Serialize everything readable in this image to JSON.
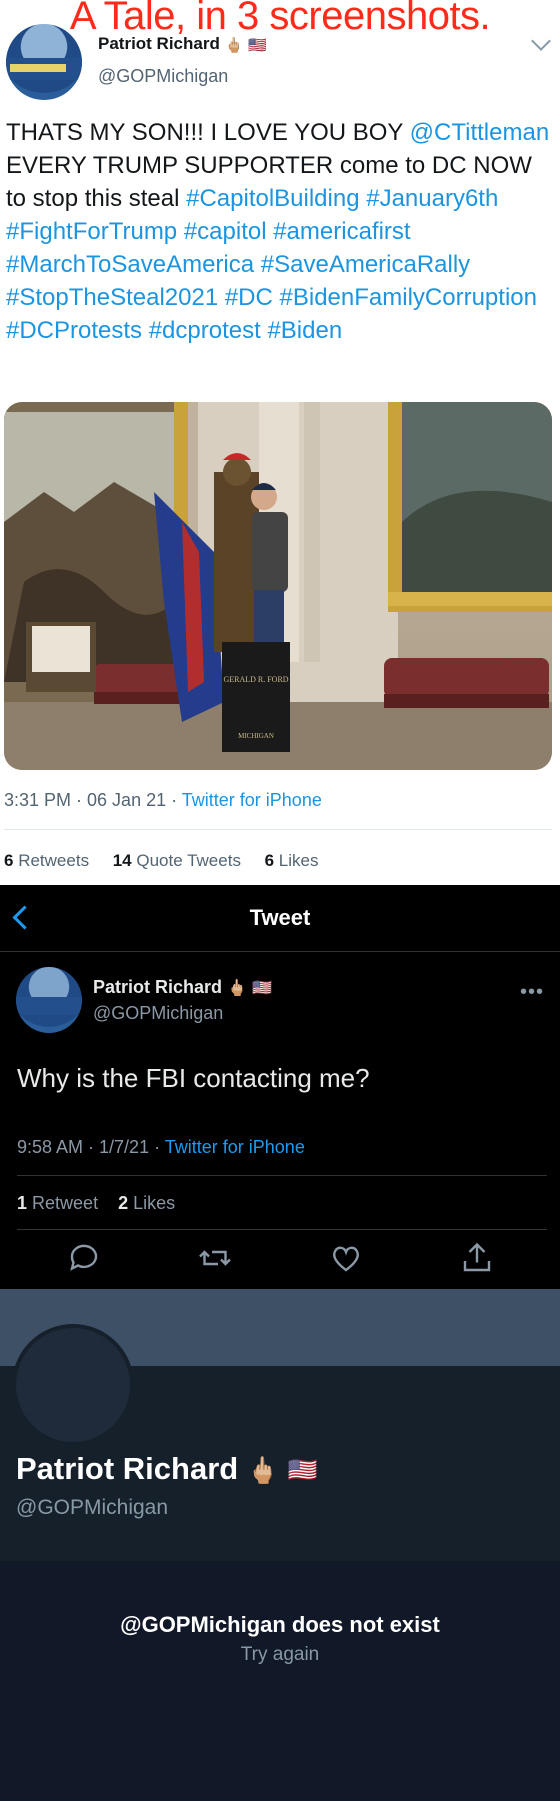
{
  "overlay": {
    "title": "A Tale, in 3 screenshots."
  },
  "tweet1": {
    "name": "Patriot Richard",
    "handle": "@GOPMichigan",
    "text_lead": "THATS MY SON!!! I LOVE YOU BOY",
    "mention": "@CTittleman",
    "text_mid": "EVERY TRUMP SUPPORTER come to DC NOW to stop this steal",
    "hashtags": "#CapitolBuilding #January6th #FightForTrump #capitol #americafirst #MarchToSaveAmerica #SaveAmericaRally #StopTheSteal2021 #DC #BidenFamilyCorruption #DCProtests #dcprotest #Biden",
    "time": "3:31 PM · 06 Jan 21 · ",
    "source": "Twitter for iPhone",
    "retweets_count": "6",
    "retweets_label": "Retweets",
    "quotes_count": "14",
    "quotes_label": "Quote Tweets",
    "likes_count": "6",
    "likes_label": "Likes",
    "photo_plaque_name": "GERALD R. FORD",
    "photo_plaque_state": "MICHIGAN"
  },
  "tweet2": {
    "header_title": "Tweet",
    "name": "Patriot Richard",
    "handle": "@GOPMichigan",
    "text": "Why is the FBI contacting me?",
    "time": "9:58 AM · 1/7/21 · ",
    "source": "Twitter for iPhone",
    "retweets_count": "1",
    "retweets_label": "Retweet",
    "likes_count": "2",
    "likes_label": "Likes",
    "more_label": "•••"
  },
  "profile": {
    "name": "Patriot Richard",
    "handle": "@GOPMichigan",
    "message": "@GOPMichigan does not exist",
    "retry": "Try again"
  },
  "colors": {
    "link_blue": "#1b95e0",
    "overlay_red": "#ff2a1a",
    "dark_bg": "#15202b"
  }
}
